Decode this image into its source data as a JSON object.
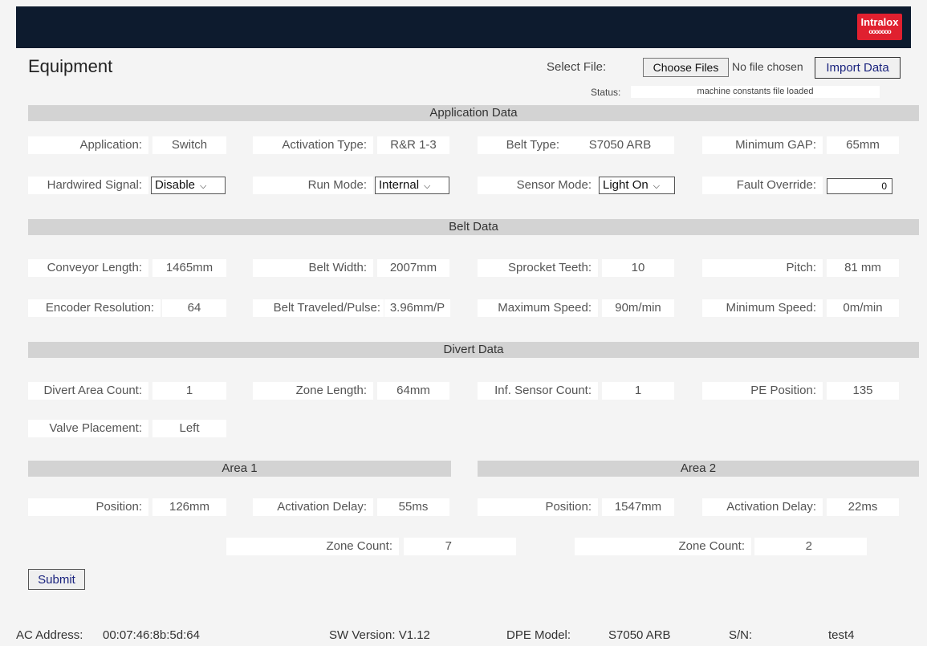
{
  "header": {
    "brand": "Intralox",
    "brand_chain": "ooooooo"
  },
  "page_title": "Equipment",
  "file": {
    "select_label": "Select File:",
    "choose_button": "Choose Files",
    "no_file": "No file chosen",
    "import_button": "Import Data",
    "status_label": "Status:",
    "status_value": "machine constants file loaded"
  },
  "application": {
    "section_title": "Application Data",
    "application_label": "Application:",
    "application_value": "Switch",
    "activation_type_label": "Activation Type:",
    "activation_type_value": "R&R 1-3",
    "belt_type_label": "Belt Type:",
    "belt_type_value": "S7050 ARB",
    "min_gap_label": "Minimum GAP:",
    "min_gap_value": "65mm",
    "hardwired_label": "Hardwired Signal:",
    "hardwired_value": "Disable",
    "run_mode_label": "Run Mode:",
    "run_mode_value": "Internal",
    "sensor_mode_label": "Sensor Mode:",
    "sensor_mode_value": "Light On",
    "fault_override_label": "Fault Override:",
    "fault_override_value": "0"
  },
  "belt": {
    "section_title": "Belt Data",
    "conveyor_length_label": "Conveyor Length:",
    "conveyor_length_value": "1465mm",
    "belt_width_label": "Belt Width:",
    "belt_width_value": "2007mm",
    "sprocket_teeth_label": "Sprocket Teeth:",
    "sprocket_teeth_value": "10",
    "pitch_label": "Pitch:",
    "pitch_value": "81 mm",
    "encoder_label": "Encoder Resolution:",
    "encoder_value": "64",
    "traveled_label": "Belt Traveled/Pulse:",
    "traveled_value": "3.96mm/P",
    "max_speed_label": "Maximum Speed:",
    "max_speed_value": "90m/min",
    "min_speed_label": "Minimum Speed:",
    "min_speed_value": "0m/min"
  },
  "divert": {
    "section_title": "Divert Data",
    "area_count_label": "Divert Area Count:",
    "area_count_value": "1",
    "zone_length_label": "Zone Length:",
    "zone_length_value": "64mm",
    "inf_sensor_label": "Inf. Sensor Count:",
    "inf_sensor_value": "1",
    "pe_position_label": "PE Position:",
    "pe_position_value": "135",
    "valve_label": "Valve Placement:",
    "valve_value": "Left"
  },
  "area1": {
    "title": "Area 1",
    "position_label": "Position:",
    "position_value": "126mm",
    "delay_label": "Activation Delay:",
    "delay_value": "55ms",
    "zone_count_label": "Zone Count:",
    "zone_count_value": "7"
  },
  "area2": {
    "title": "Area 2",
    "position_label": "Position:",
    "position_value": "1547mm",
    "delay_label": "Activation Delay:",
    "delay_value": "22ms",
    "zone_count_label": "Zone Count:",
    "zone_count_value": "2"
  },
  "submit_label": "Submit",
  "footer": {
    "mac_label": "AC Address:",
    "mac_value": "00:07:46:8b:5d:64",
    "sw_version": "SW Version: V1.12",
    "dpe_label": "DPE Model:",
    "dpe_value": "S7050 ARB",
    "sn_label": "S/N:",
    "sn_value": "test4"
  }
}
